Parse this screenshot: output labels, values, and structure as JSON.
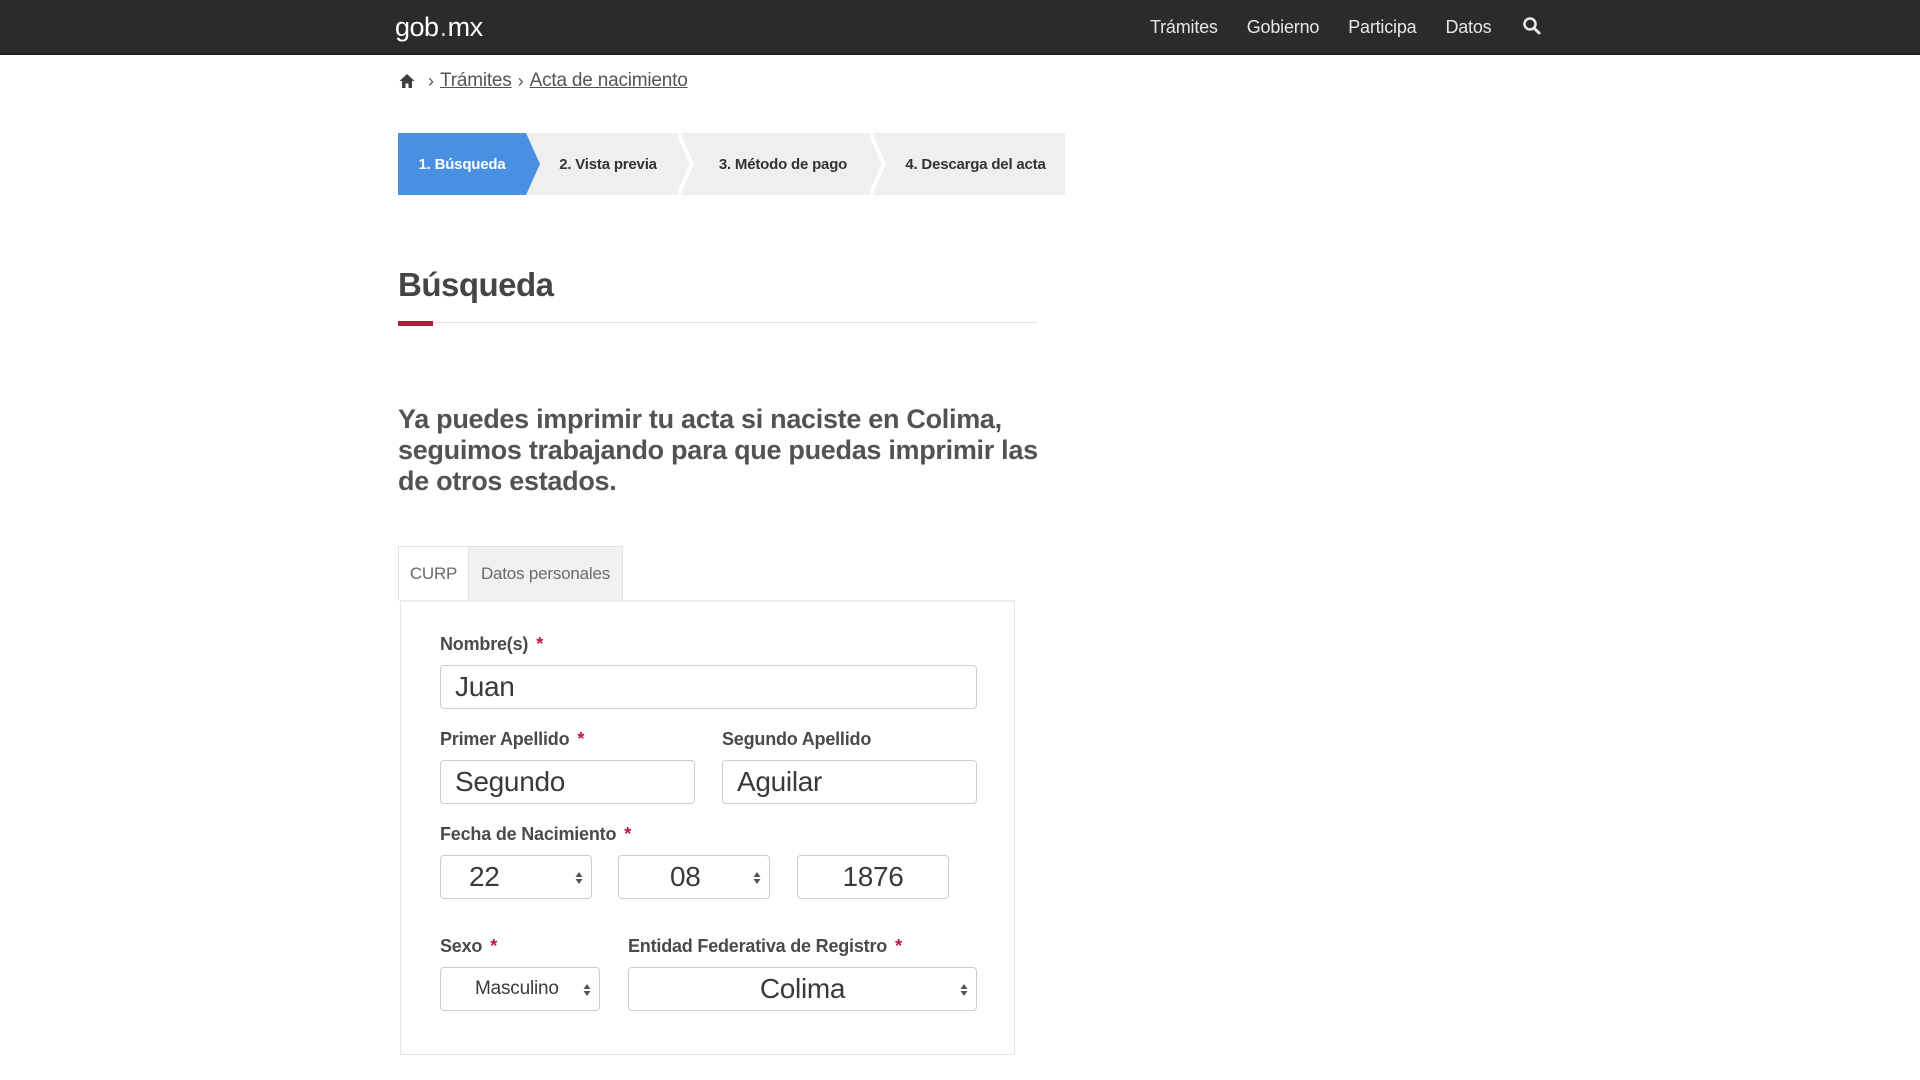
{
  "navbar": {
    "logo_left": "gob",
    "logo_dot": ".",
    "logo_right": "mx",
    "links": [
      "Trámites",
      "Gobierno",
      "Participa",
      "Datos"
    ],
    "search_icon": "search-icon"
  },
  "breadcrumb": {
    "home_icon": "home-icon",
    "separator": "›",
    "items": [
      "Trámites",
      "Acta de nacimiento"
    ]
  },
  "stepper": {
    "steps": [
      "1. Búsqueda",
      "2. Vista previa",
      "3. Método de pago",
      "4. Descarga del acta"
    ],
    "active_index": 0,
    "active_color": "#4a90e2"
  },
  "page": {
    "title": "Búsqueda",
    "accent_color": "#c1143b",
    "intro": "Ya puedes imprimir tu acta si naciste en Colima, seguimos trabajando para que puedas imprimir las de otros estados."
  },
  "tabs": [
    "CURP",
    "Datos personales"
  ],
  "form": {
    "required_mark": "*",
    "nombre": {
      "label": "Nombre(s)",
      "value": "Juan"
    },
    "primer_apellido": {
      "label": "Primer Apellido",
      "value": "Segundo"
    },
    "segundo_apellido": {
      "label": "Segundo Apellido",
      "value": "Aguilar"
    },
    "fecha": {
      "label": "Fecha de Nacimiento",
      "day": "22",
      "month": "08",
      "year": "1876"
    },
    "sexo": {
      "label": "Sexo",
      "value": "Masculino"
    },
    "entidad": {
      "label": "Entidad Federativa de Registro",
      "value": "Colima"
    }
  }
}
